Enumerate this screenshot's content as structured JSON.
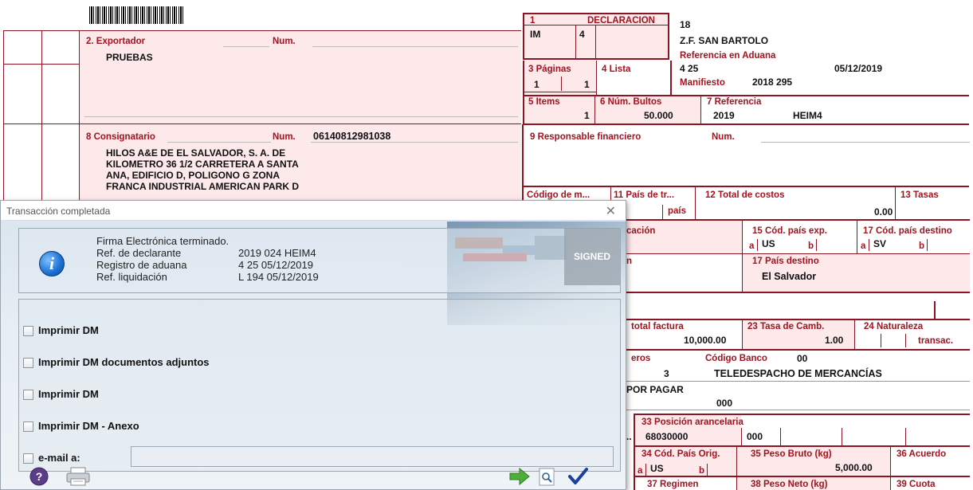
{
  "form": {
    "box1_num": "1",
    "box1_label": "DECLARACION",
    "box1_type": "IM",
    "box1_code": "4",
    "decl_num": "18",
    "zona_franca": "Z.F. SAN BARTOLO",
    "ref_aduana_label": "Referencia en Aduana",
    "ref_aduana_value": "4  25",
    "ref_aduana_date": "05/12/2019",
    "manifiesto_label": "Manifiesto",
    "manifiesto_value": "2018 295",
    "exportador_label": "2. Exportador",
    "exportador_num_label": "Num.",
    "exportador_name": "PRUEBAS",
    "paginas_label": "3 Páginas",
    "paginas_a": "1",
    "paginas_b": "1",
    "lista_label": "4 Lista",
    "items_label": "5 Items",
    "items_value": "1",
    "bultos_label": "6 Núm. Bultos",
    "bultos_value": "50.000",
    "referencia_label": "7 Referencia",
    "referencia_year": "2019",
    "referencia_code": "HEIM4",
    "consignatario_label": "8 Consignatario",
    "consignatario_num_label": "Num.",
    "consignatario_num": "06140812981038",
    "consignatario_lines": [
      "HILOS A&E DE EL SALVADOR, S. A. DE",
      "KILOMETRO 36 1/2 CARRETERA A SANTA",
      "ANA, EDIFICIO D, POLIGONO G  ZONA",
      "FRANCA INDUSTRIAL AMERICAN PARK D"
    ],
    "resp_fin_label": "9 Responsable financiero",
    "resp_fin_num_label": "Num.",
    "codigo_m_label": "Código de m...",
    "pais_tr_label": "11 País de tr...",
    "pais_word": "país",
    "total_costos_label": "12 Total de costos",
    "total_costos_value": "0.00",
    "tasas_label": "13 Tasas",
    "cacion_label": "cación",
    "cod_pais_exp_label": "15 Cód. país exp.",
    "cod_pais_exp_a": "US",
    "cod_pais_dest_label": "17 Cód. país destino",
    "cod_pais_dest_a": "SV",
    "a_mark": "a",
    "b_mark": "b",
    "n_fragment": "n",
    "pais_destino_label": "17 País destino",
    "pais_destino_value": "El Salvador",
    "total_factura_label": "total factura",
    "total_factura_value": "10,000.00",
    "tasa_camb_label": "23 Tasa de Camb.",
    "tasa_camb_value": "1.00",
    "naturaleza_label": "24 Naturaleza",
    "transac_label": "transac.",
    "eros_label": "eros",
    "codigo_banco_label": "Código Banco",
    "codigo_banco_value": "00",
    "despacho_num": "3",
    "despacho_name": "TELEDESPACHO DE MERCANCÍAS",
    "por_pagar": "POR PAGAR",
    "por_pagar_code": "000",
    "posicion_label": "33 Posición arancelaria",
    "posicion_value": "68030000",
    "posicion_sub": "000",
    "dots": "..",
    "cod_pais_orig_label": "34 Cód. País Orig.",
    "cod_pais_orig_value": "US",
    "peso_bruto_label": "35 Peso Bruto (kg)",
    "peso_bruto_value": "5,000.00",
    "acuerdo_label": "36 Acuerdo",
    "regimen_label": "37 Regimen",
    "peso_neto_label": "38 Peso Neto (kg)",
    "cuota_label": "39 Cuota"
  },
  "dialog": {
    "title": "Transacción completada",
    "close_glyph": "✕",
    "info_glyph": "i",
    "line1": "Firma Electrónica terminado.",
    "rows": [
      {
        "label": "Ref. de declarante",
        "value": "2019 024 HEIM4"
      },
      {
        "label": "Registro de aduana",
        "value": "4 25 05/12/2019"
      },
      {
        "label": "Ref. liquidación",
        "value": "L 194 05/12/2019"
      }
    ],
    "signed_label": "SIGNED",
    "options": [
      "Imprimir DM",
      "Imprimir DM documentos adjuntos",
      "Imprimir DM",
      "Imprimir DM - Anexo"
    ],
    "email_label": "e-mail a:",
    "email_value": ""
  },
  "colors": {
    "form_label": "#a3131f",
    "form_border": "#8b1522",
    "form_bg": "#fde8ea"
  }
}
